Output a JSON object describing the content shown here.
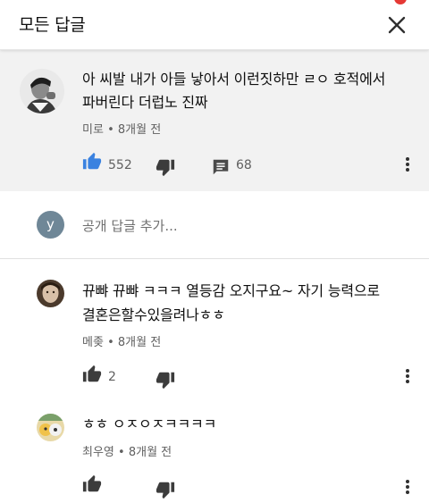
{
  "header": {
    "title": "모든 답글"
  },
  "main_comment": {
    "text_line1": "아 씨발 내가 아들 낳아서 이런짓하만 ㄹㅇ 호적에서",
    "text_line2": "파버린다 더럽노 진짜",
    "author": "미로",
    "time": "8개월 전",
    "likes": "552",
    "replies": "68"
  },
  "reply_box": {
    "avatar_letter": "y",
    "placeholder": "공개 답글 추가..."
  },
  "replies": [
    {
      "text_line1": "뀨뺘 뀨뺘 ㅋㅋㅋ 열등감 오지구요~ 자기 능력으로",
      "text_line2": "결혼은할수있을려나ㅎㅎ",
      "author": "메좆",
      "time": "8개월 전",
      "likes": "2"
    },
    {
      "text_line1": "ㅎㅎ ㅇㅈㅇㅈㅋㅋㅋㅋ",
      "author": "최우영",
      "time": "8개월 전",
      "likes": ""
    }
  ],
  "colors": {
    "main_bg": "#f2f2f2",
    "like_active": "#3a82e0",
    "icon_gray": "#606060",
    "notification": "#e53935"
  }
}
